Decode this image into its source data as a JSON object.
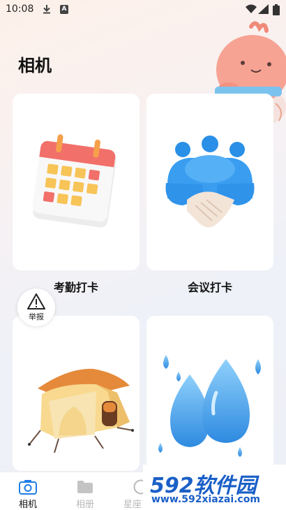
{
  "status_bar": {
    "time": "10:08",
    "a_badge": "A",
    "icons": [
      "download-icon",
      "a-badge-icon",
      "wifi-icon",
      "signal-icon",
      "battery-icon"
    ]
  },
  "header": {
    "title": "相机"
  },
  "cards": [
    {
      "label": "考勤打卡",
      "icon": "calendar-icon"
    },
    {
      "label": "会议打卡",
      "icon": "handshake-icon"
    },
    {
      "label": "",
      "icon": "tent-icon"
    },
    {
      "label": "",
      "icon": "water-drops-icon"
    }
  ],
  "report_button": {
    "label": "举报",
    "icon": "warning-icon"
  },
  "tabs": [
    {
      "label": "相机",
      "icon": "camera-icon",
      "active": true
    },
    {
      "label": "相册",
      "icon": "folder-icon",
      "active": false
    },
    {
      "label": "星座",
      "icon": "star-icon",
      "active": false
    }
  ],
  "watermark": {
    "logo": "592软件园",
    "url": "www.592xiazai.com"
  },
  "colors": {
    "accent": "#1f7de6",
    "inactive_tab": "#b8b8b8",
    "watermark_blue": "#1a5fc7"
  }
}
